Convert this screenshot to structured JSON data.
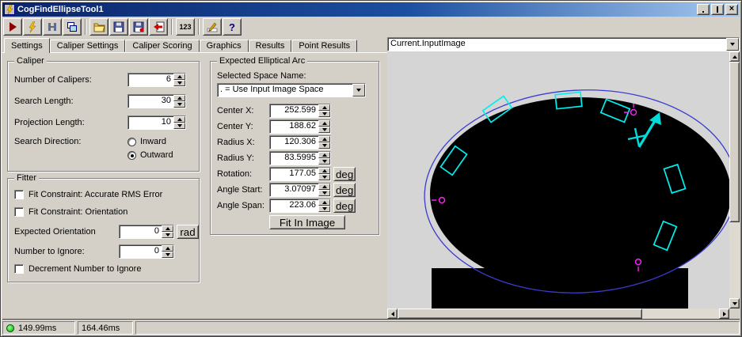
{
  "window": {
    "title": "CogFindEllipseTool1"
  },
  "titlebar": {
    "buttons": [
      "minimize-icon",
      "maximize-icon",
      "close-icon"
    ],
    "close_glyph": "×"
  },
  "toolbar": {
    "icons": [
      "run-icon",
      "run-live-icon",
      "electrode-icon",
      "tool-windows-icon",
      "open-file-icon",
      "save-file-icon",
      "save-image-icon",
      "import-icon",
      "numeric-display-icon",
      "edit-graphics-icon",
      "help-icon"
    ],
    "numeric_label": "123",
    "help_label": "?"
  },
  "tabs": [
    "Settings",
    "Caliper Settings",
    "Caliper Scoring",
    "Graphics",
    "Results",
    "Point Results"
  ],
  "caliper": {
    "title": "Caliper",
    "fields": [
      {
        "label": "Number of Calipers:",
        "value": "6"
      },
      {
        "label": "Search Length:",
        "value": "30"
      },
      {
        "label": "Projection Length:",
        "value": "10"
      }
    ],
    "search_direction": {
      "label": "Search Direction:",
      "options": [
        {
          "label": "Inward",
          "selected": false
        },
        {
          "label": "Outward",
          "selected": true
        }
      ]
    }
  },
  "fitter": {
    "title": "Fitter",
    "fit_constraint_rms": "Fit Constraint: Accurate RMS Error",
    "fit_constraint_orientation": "Fit Constraint: Orientation",
    "expected_orientation": {
      "label": "Expected Orientation",
      "value": "0",
      "unit": "rad"
    },
    "number_to_ignore": {
      "label": "Number to Ignore:",
      "value": "0"
    },
    "decrement": "Decrement Number to Ignore"
  },
  "arc": {
    "title": "Expected Elliptical Arc",
    "space_name_label": "Selected Space Name:",
    "space_name_value": ". = Use Input Image Space",
    "fields": [
      {
        "label": "Center X:",
        "value": "252.599",
        "unit": ""
      },
      {
        "label": "Center Y:",
        "value": "188.62",
        "unit": ""
      },
      {
        "label": "Radius X:",
        "value": "120.306",
        "unit": ""
      },
      {
        "label": "Radius Y:",
        "value": "83.5995",
        "unit": ""
      },
      {
        "label": "Rotation:",
        "value": "177.05",
        "unit": "deg"
      },
      {
        "label": "Angle Start:",
        "value": "3.07097",
        "unit": "deg"
      },
      {
        "label": "Angle Span:",
        "value": "223.06",
        "unit": "deg"
      }
    ],
    "fit_button": "Fit In Image"
  },
  "image_panel": {
    "source": "Current.InputImage",
    "overlay_colors": {
      "ellipse_outline": "#3b3bd1",
      "caliper": "#00efef",
      "marker": "#ff22ff",
      "arrow": "#00dcdc"
    }
  },
  "status": {
    "time1": "149.99ms",
    "time2": "164.46ms",
    "led_color": "#00b000"
  }
}
